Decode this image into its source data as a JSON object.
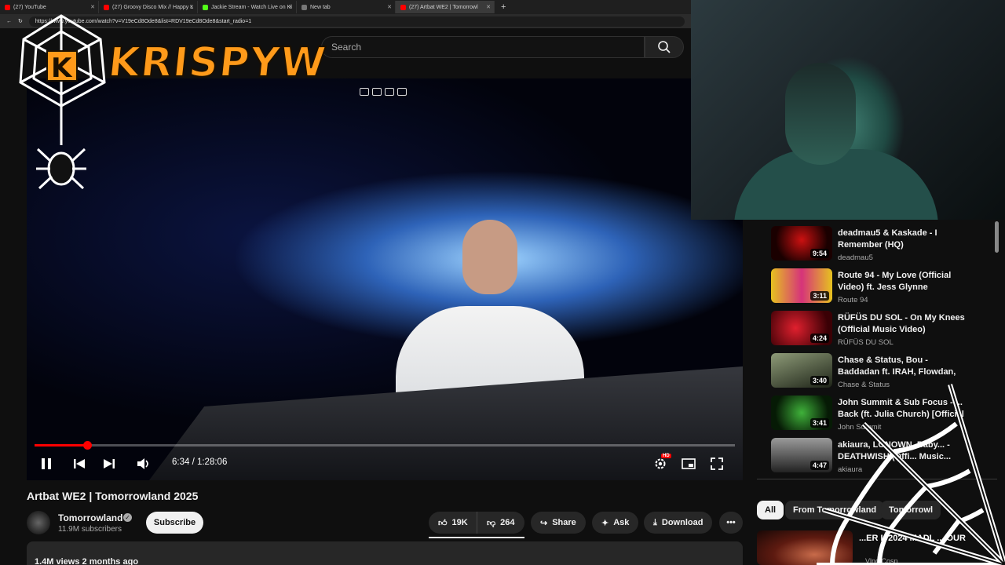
{
  "browser": {
    "tabs": [
      {
        "label": "(27) YouTube",
        "icon": "youtube-icon",
        "active": false
      },
      {
        "label": "(27) Groovy Disco Mix // Happy L",
        "icon": "youtube-icon",
        "active": false
      },
      {
        "label": "Jackie Stream - Watch Live on Ki",
        "icon": "kick-icon",
        "active": false
      },
      {
        "label": "New tab",
        "icon": "newtab-icon",
        "active": false
      },
      {
        "label": "(27) Artbat WE2 | Tomorrowl",
        "icon": "youtube-icon",
        "active": true
      }
    ],
    "url": "https://www.youtube.com/watch?v=V19eCd8Ode8&list=RDV19eCd8Ode8&start_radio=1"
  },
  "header": {
    "search_placeholder": "Search"
  },
  "overlay": {
    "logo_text": "KRISPYW"
  },
  "player": {
    "current_time": "6:34",
    "duration": "1:28:06",
    "time_display": "6:34 / 1:28:06",
    "progress_fraction": 0.0746,
    "playing": true,
    "hd_badge": "HD"
  },
  "video": {
    "title": "Artbat WE2 | Tomorrowland 2025",
    "channel": "Tomorrowland",
    "subscribers": "11.9M subscribers",
    "subscribe_label": "Subscribe",
    "likes": "19K",
    "dislikes": "264",
    "share_label": "Share",
    "ask_label": "Ask",
    "download_label": "Download",
    "views": "1.4M views  2 months ago"
  },
  "sidebar": {
    "recommendations": [
      {
        "title": "deadmau5 & Kaskade - I Remember (HQ)",
        "channel": "deadmau5",
        "duration": "9:54",
        "thumb_colors": [
          "#1a0000",
          "#cc1111"
        ]
      },
      {
        "title": "Route 94 - My Love (Official Video) ft. Jess Glynne",
        "channel": "Route 94",
        "duration": "3:11",
        "thumb_colors": [
          "#e6c21f",
          "#d6337a"
        ]
      },
      {
        "title": "RÜFÜS DU SOL - On My Knees (Official Music Video)",
        "channel": "RÜFÜS DU SOL",
        "duration": "4:24",
        "thumb_colors": [
          "#b00010",
          "#3a0005"
        ]
      },
      {
        "title": "Chase & Status, Bou - Baddadan ft. IRAH, Flowdan, Trigga,...",
        "channel": "Chase & Status",
        "duration": "3:40",
        "thumb_colors": [
          "#6d7a5a",
          "#1e2418"
        ]
      },
      {
        "title": "John Summit & Sub Focus - ... Back (ft. Julia Church) [Official",
        "channel": "John Summit",
        "duration": "3:41",
        "thumb_colors": [
          "#1d5a1a",
          "#061a05"
        ]
      },
      {
        "title": "akiaura, LONOWN, Baby... - DEATHWISH (Offi... Music...",
        "channel": "akiaura",
        "duration": "4:47",
        "thumb_colors": [
          "#7c7c7c",
          "#222222"
        ]
      }
    ],
    "chips": [
      "All",
      "From Tomorrowland",
      "Tomorrowl"
    ],
    "bottom_rec": {
      "title": "...ER L 2024 MADL ... OUR",
      "channel": "Vlnd Cosn..."
    }
  }
}
